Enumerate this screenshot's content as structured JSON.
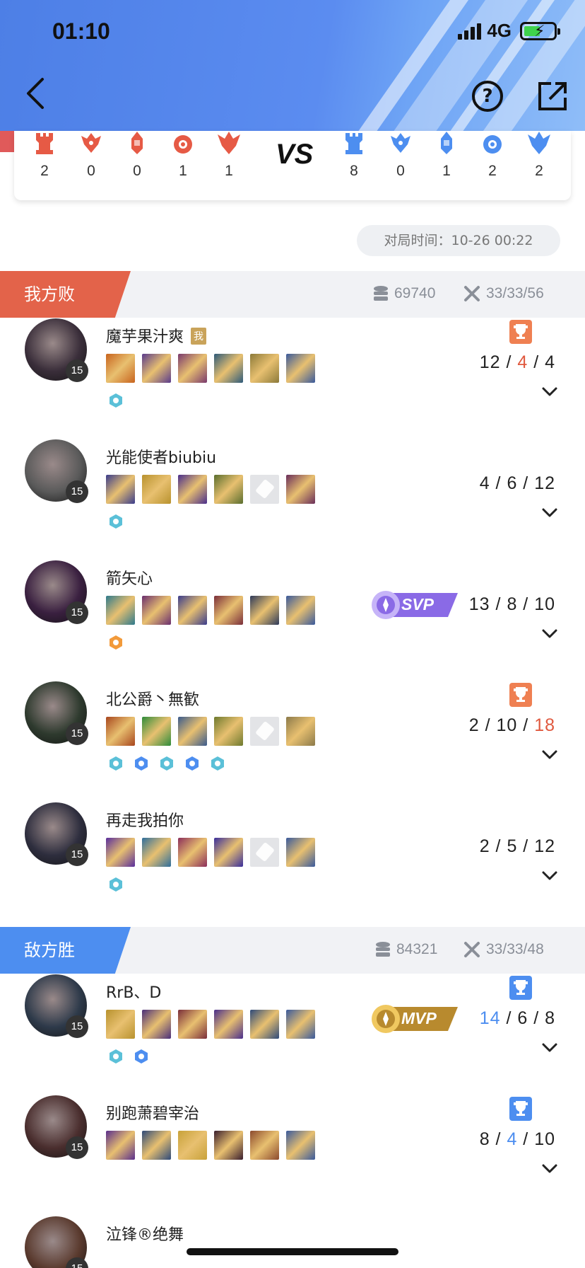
{
  "status_bar": {
    "time": "01:10",
    "network": "4G"
  },
  "score": {
    "left": [
      "2",
      "0",
      "0",
      "1",
      "1"
    ],
    "vs": "VS",
    "right": [
      "8",
      "0",
      "1",
      "2",
      "2"
    ],
    "left_color": "#e65a45",
    "right_color": "#4d8ef0"
  },
  "match_time": "对局时间：10-26 00:22",
  "teams": [
    {
      "label": "我方败",
      "gold": "69740",
      "kda_total": "33/33/56",
      "color": "#e3634a",
      "players": [
        {
          "name": "魔芋果汁爽",
          "me_badge": "我",
          "level": "15",
          "k": "12",
          "d": "4",
          "a": "4",
          "highlight": "d",
          "trophy": "red",
          "badge": "",
          "runes": 1
        },
        {
          "name": "光能使者biubiu",
          "me_badge": "",
          "level": "15",
          "k": "4",
          "d": "6",
          "a": "12",
          "highlight": "",
          "trophy": "",
          "badge": "",
          "runes": 1
        },
        {
          "name": "箭矢心",
          "me_badge": "",
          "level": "15",
          "k": "13",
          "d": "8",
          "a": "10",
          "highlight": "",
          "trophy": "",
          "badge": "SVP",
          "runes": 1
        },
        {
          "name": "北公爵丶無歓",
          "me_badge": "",
          "level": "15",
          "k": "2",
          "d": "10",
          "a": "18",
          "highlight": "a",
          "trophy": "red",
          "badge": "",
          "runes": 5
        },
        {
          "name": "再走我拍你",
          "me_badge": "",
          "level": "15",
          "k": "2",
          "d": "5",
          "a": "12",
          "highlight": "",
          "trophy": "",
          "badge": "",
          "runes": 1
        }
      ]
    },
    {
      "label": "敌方胜",
      "gold": "84321",
      "kda_total": "33/33/48",
      "color": "#4d8ef0",
      "players": [
        {
          "name": "RrB、D",
          "me_badge": "",
          "level": "15",
          "k": "14",
          "d": "6",
          "a": "8",
          "highlight": "k",
          "trophy": "blue",
          "badge": "MVP",
          "runes": 2
        },
        {
          "name": "别跑萧碧宰治",
          "me_badge": "",
          "level": "15",
          "k": "8",
          "d": "4",
          "a": "10",
          "highlight": "d",
          "trophy": "blue",
          "badge": "",
          "runes": 0
        },
        {
          "name": "泣锋®绝舞",
          "me_badge": "",
          "level": "15",
          "k": "",
          "d": "",
          "a": "",
          "highlight": "",
          "trophy": "",
          "badge": "",
          "runes": 0
        }
      ]
    }
  ],
  "icons": {
    "back": "chevron-left-icon",
    "help": "question-circle-icon",
    "share": "external-link-icon",
    "gold": "coin-stack-icon",
    "kda": "crossed-swords-icon",
    "expand": "chevron-down-icon"
  },
  "help_glyph": "?"
}
